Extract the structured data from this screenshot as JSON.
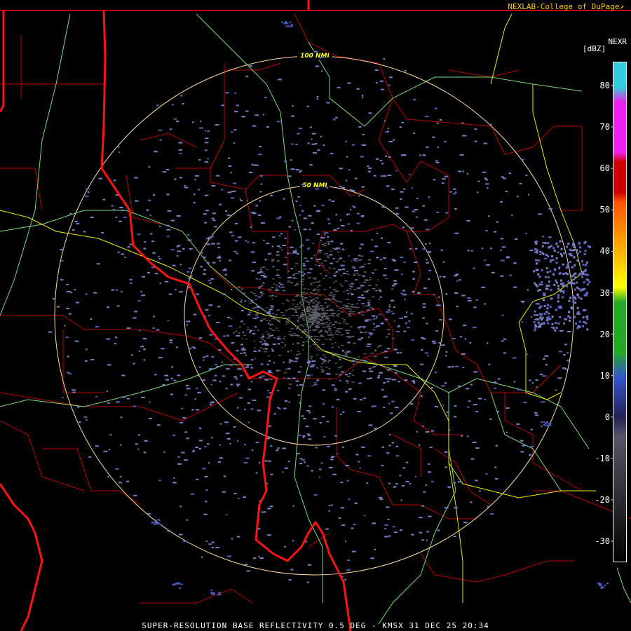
{
  "header": {
    "credit": "NEXLAB-College of DuPage",
    "credit_icon": "external-link-icon"
  },
  "legend": {
    "product": "NEXR",
    "unit": "[dBZ]",
    "ticks": [
      "80",
      "70",
      "60",
      "50",
      "40",
      "30",
      "20",
      "10",
      "0",
      "-10",
      "-20",
      "-30"
    ],
    "colors": {
      "80": "#33ccdd",
      "70": "#ee22ee",
      "60": "#cc0000",
      "50": "#ff5500",
      "40": "#ffaa00",
      "30": "#ffff00",
      "20": "#22aa22",
      "10": "#3355cc",
      "0": "#222255",
      "-10": "#555566",
      "-20": "#2a2a30",
      "-30": "#000000"
    }
  },
  "map": {
    "rings": [
      {
        "label": "100 NMI"
      },
      {
        "label": "50 NMI"
      }
    ],
    "colors": {
      "state_border": "#ff0000",
      "county": "#cc0000",
      "highway": "#88ee88",
      "river": "#ffff00",
      "ring": "#ffdd99",
      "echo": "#7a80c8"
    }
  },
  "footer": {
    "text": "SUPER-RESOLUTION BASE REFLECTIVITY 0.5 DEG - KMSX 31 DEC 25 20:34"
  }
}
